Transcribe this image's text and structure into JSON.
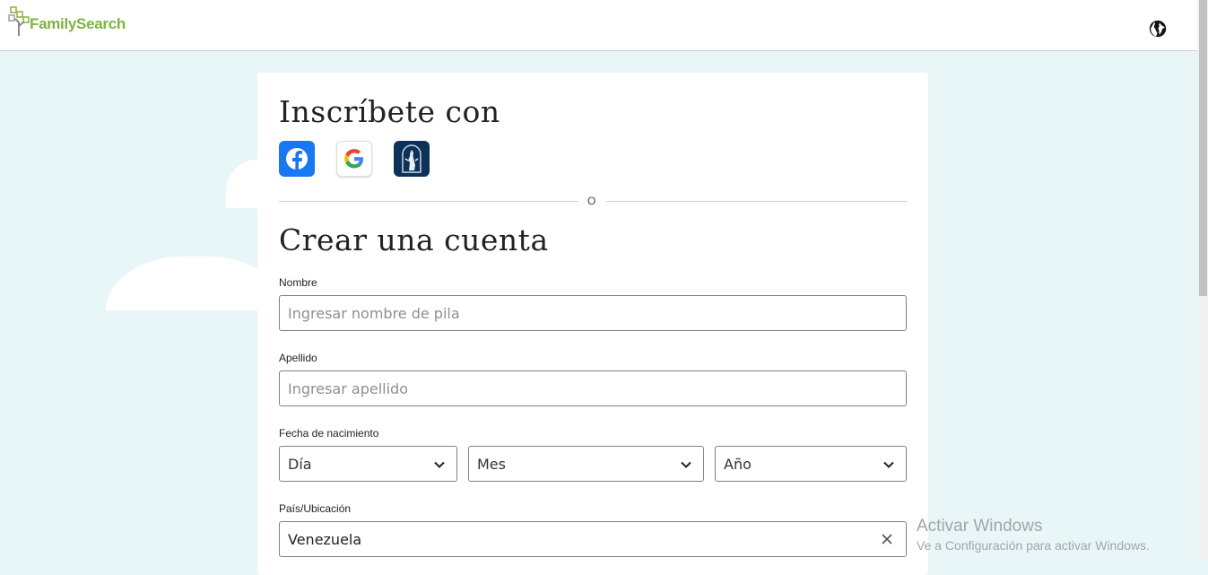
{
  "header": {
    "brand": "FamilySearch",
    "brand_color": "#7cb342",
    "language_icon": "globe-icon"
  },
  "signin": {
    "title": "Inscríbete con",
    "providers": [
      "facebook-icon",
      "google-icon",
      "church-icon"
    ],
    "divider_text": "O"
  },
  "form": {
    "title": "Crear una cuenta",
    "first_name": {
      "label": "Nombre",
      "placeholder": "Ingresar nombre de pila",
      "value": ""
    },
    "last_name": {
      "label": "Apellido",
      "placeholder": "Ingresar apellido",
      "value": ""
    },
    "birth_date": {
      "label": "Fecha de nacimiento",
      "day": "Día",
      "month": "Mes",
      "year": "Año"
    },
    "country": {
      "label": "País/Ubicación",
      "value": "Venezuela"
    }
  },
  "watermark": {
    "line1": "Activar Windows",
    "line2": "Ve a Configuración para activar Windows."
  }
}
